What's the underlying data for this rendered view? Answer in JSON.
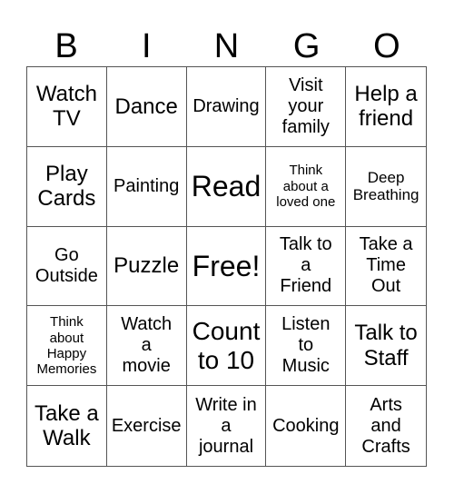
{
  "header": [
    "B",
    "I",
    "N",
    "G",
    "O"
  ],
  "cells": [
    "Watch\nTV",
    "Dance",
    "Drawing",
    "Visit\nyour\nfamily",
    "Help a\nfriend",
    "Play\nCards",
    "Painting",
    "Read",
    "Think\nabout a\nloved one",
    "Deep\nBreathing",
    "Go\nOutside",
    "Puzzle",
    "Free!",
    "Talk to\na\nFriend",
    "Take a\nTime\nOut",
    "Think\nabout\nHappy\nMemories",
    "Watch\na\nmovie",
    "Count\nto 10",
    "Listen\nto\nMusic",
    "Talk to\nStaff",
    "Take a\nWalk",
    "Exercise",
    "Write in\na\njournal",
    "Cooking",
    "Arts\nand\nCrafts"
  ]
}
